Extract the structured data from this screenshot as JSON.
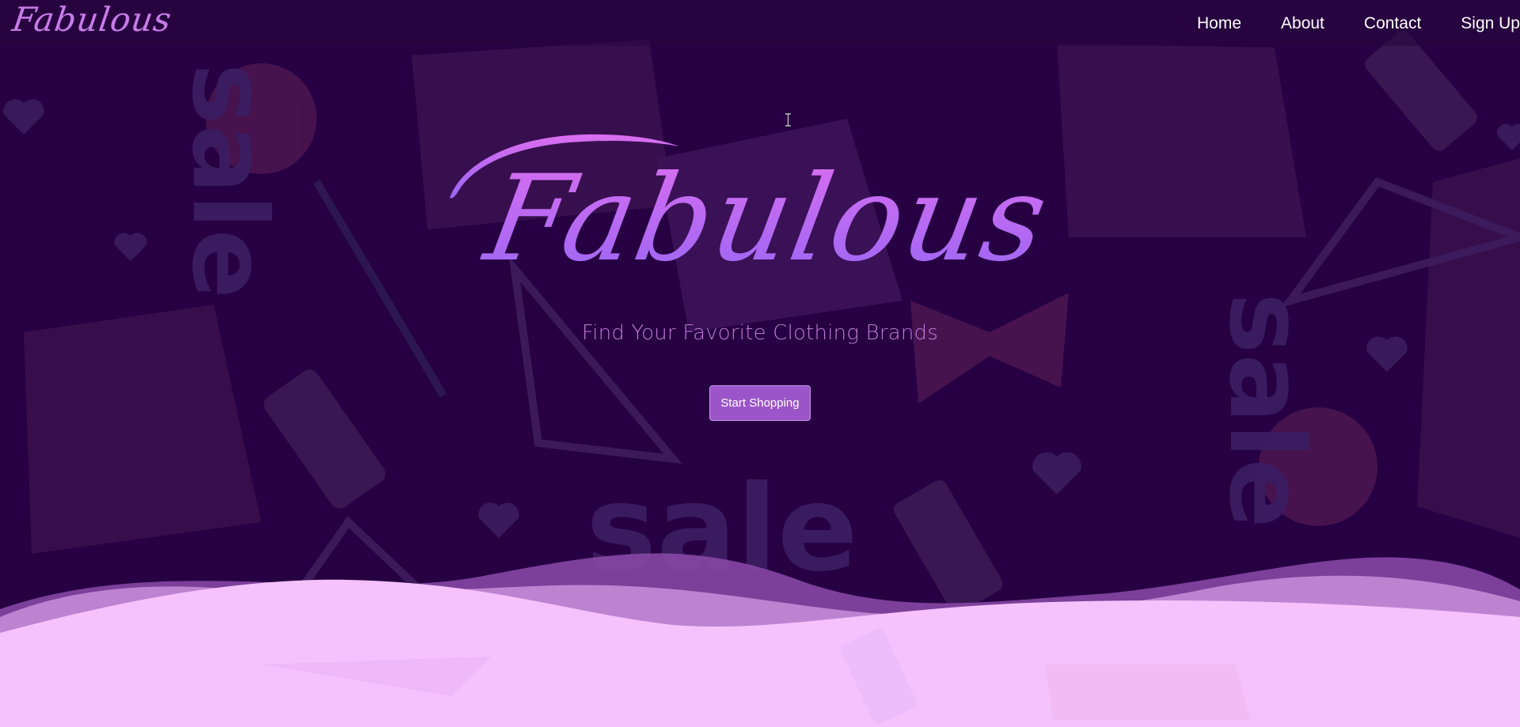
{
  "brand": {
    "logo_text": "Fabulous",
    "hero_title": "Fabulous",
    "hero_subtitle": "Find Your Favorite Clothing Brands"
  },
  "nav": {
    "items": [
      {
        "label": "Home"
      },
      {
        "label": "About"
      },
      {
        "label": "Contact"
      },
      {
        "label": "Sign Up"
      }
    ]
  },
  "cta": {
    "label": "Start Shopping"
  },
  "background": {
    "pattern_text": "sale",
    "icons": [
      "shopping-bag-icon",
      "rose-icon",
      "lipstick-icon",
      "heart-icon",
      "hanger-icon",
      "bow-icon",
      "heel-icon"
    ]
  },
  "colors": {
    "background": "#260042",
    "accent": "#9b55c8",
    "title_gradient_start": "#d86ef0",
    "title_gradient_end": "#9a6af4",
    "wave_front": "#f5c2fe",
    "wave_mid": "#c38cd8",
    "wave_back": "#9c5fb6"
  }
}
